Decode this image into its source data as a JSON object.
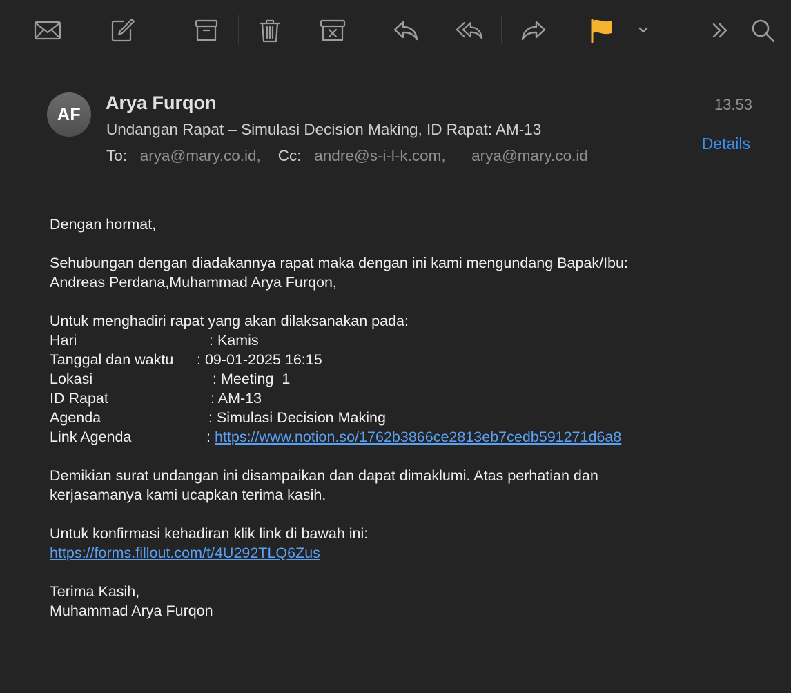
{
  "toolbar": {
    "icons": [
      "mail-icon",
      "compose-icon",
      "archive-icon",
      "trash-icon",
      "junk-icon",
      "reply-icon",
      "reply-all-icon",
      "forward-icon",
      "flag-icon",
      "chevron-down-icon",
      "more-icon",
      "search-icon"
    ],
    "flag_color": "#f5b32e"
  },
  "header": {
    "avatar_initials": "AF",
    "sender": "Arya Furqon",
    "time": "13.53",
    "subject": "Undangan Rapat – Simulasi Decision Making, ID Rapat: AM-13",
    "to_label": "To:",
    "to": "arya@mary.co.id,",
    "cc_label": "Cc:",
    "cc": [
      "andre@s-i-l-k.com,",
      "arya@mary.co.id"
    ],
    "details_label": "Details"
  },
  "body": {
    "greeting": "Dengan hormat,",
    "intro_1": "Sehubungan dengan diadakannya rapat maka dengan ini kami mengundang Bapak/Ibu:",
    "intro_2": "Andreas Perdana,Muhammad Arya Furqon,",
    "schedule_intro": "Untuk menghadiri rapat yang akan dilaksanakan pada:",
    "details": [
      {
        "key": "Hari",
        "value": ": Kamis"
      },
      {
        "key": "Tanggal dan waktu",
        "value": ": 09-01-2025 16:15"
      },
      {
        "key": "Lokasi",
        "value": ": Meeting  1"
      },
      {
        "key": "ID Rapat",
        "value": ": AM-13"
      },
      {
        "key": "Agenda",
        "value": ": Simulasi Decision Making"
      }
    ],
    "agenda_link_key": "Link Agenda",
    "agenda_link_colon": ":",
    "agenda_link": "https://www.notion.so/1762b3866ce2813eb7cedb591271d6a8",
    "closing_1": "Demikian surat undangan ini disampaikan dan dapat dimaklumi. Atas perhatian dan",
    "closing_2": "kerjasamanya kami ucapkan terima kasih.",
    "confirm_text": "Untuk konfirmasi kehadiran klik link di bawah ini:",
    "confirm_link": "https://forms.fillout.com/t/4U292TLQ6Zus",
    "signoff": "Terima Kasih,",
    "signature": "Muhammad Arya Furqon"
  }
}
